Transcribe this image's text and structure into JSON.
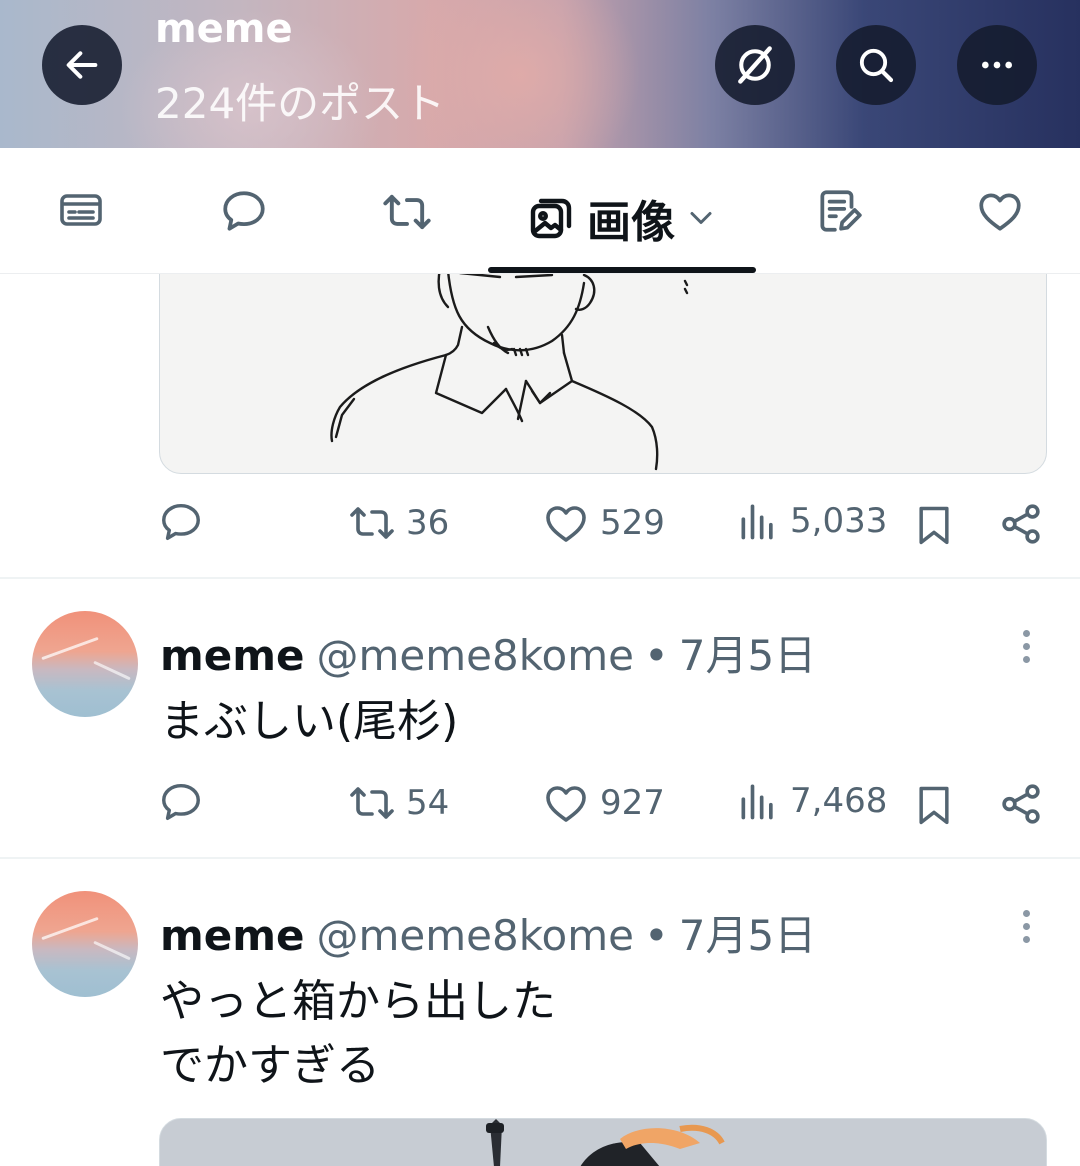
{
  "header": {
    "title": "meme",
    "subtitle": "224件のポスト"
  },
  "tabs": {
    "active_label": "画像"
  },
  "posts": [
    {
      "stats": {
        "reposts": "36",
        "likes": "529",
        "views": "5,033"
      }
    },
    {
      "name": "meme",
      "handle": "@meme8kome",
      "separator": "•",
      "date": "7月5日",
      "text_lines": [
        "まぶしい(尾杉)"
      ],
      "stats": {
        "reposts": "54",
        "likes": "927",
        "views": "7,468"
      }
    },
    {
      "name": "meme",
      "handle": "@meme8kome",
      "separator": "•",
      "date": "7月5日",
      "text_lines": [
        "やっと箱から出した",
        "でかすぎる"
      ]
    }
  ],
  "icons": {
    "back": "arrow-left-icon",
    "grok": "grok-icon",
    "search": "search-icon",
    "more": "more-horizontal-icon",
    "reply": "reply-icon",
    "repost": "repost-icon",
    "like": "heart-icon",
    "views": "views-icon",
    "bookmark": "bookmark-icon",
    "share": "share-icon"
  },
  "colors": {
    "text": "#0f1419",
    "secondary": "#536471",
    "header_button": "#141b2d"
  }
}
